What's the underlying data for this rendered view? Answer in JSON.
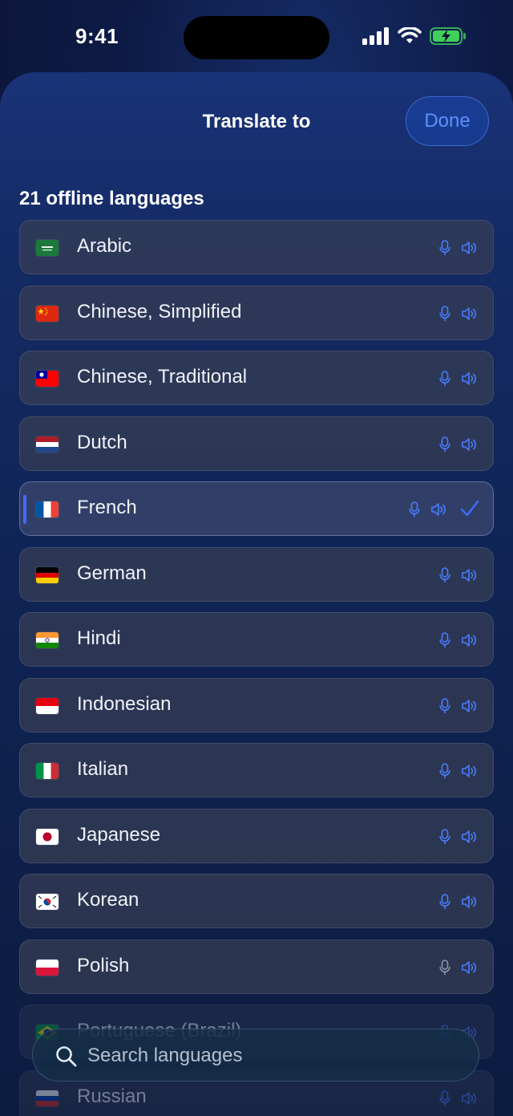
{
  "status": {
    "time": "9:41"
  },
  "sheet": {
    "title": "Translate to",
    "done_label": "Done",
    "section_header": "21 offline languages"
  },
  "languages": [
    {
      "name": "Arabic",
      "flag": "sa",
      "selected": false
    },
    {
      "name": "Chinese, Simplified",
      "flag": "cn",
      "selected": false
    },
    {
      "name": "Chinese, Traditional",
      "flag": "tw",
      "selected": false
    },
    {
      "name": "Dutch",
      "flag": "nl",
      "selected": false
    },
    {
      "name": "French",
      "flag": "fr",
      "selected": true
    },
    {
      "name": "German",
      "flag": "de",
      "selected": false
    },
    {
      "name": "Hindi",
      "flag": "in",
      "selected": false
    },
    {
      "name": "Indonesian",
      "flag": "id",
      "selected": false
    },
    {
      "name": "Italian",
      "flag": "it",
      "selected": false
    },
    {
      "name": "Japanese",
      "flag": "jp",
      "selected": false
    },
    {
      "name": "Korean",
      "flag": "kr",
      "selected": false
    },
    {
      "name": "Polish",
      "flag": "pl",
      "selected": false
    },
    {
      "name": "Portuguese (Brazil)",
      "flag": "br",
      "selected": false
    },
    {
      "name": "Russian",
      "flag": "ru",
      "selected": false
    }
  ],
  "search": {
    "placeholder": "Search languages"
  },
  "colors": {
    "accent": "#3f6dff",
    "icon_blue": "#4a7cff",
    "icon_gray": "#8a93a8",
    "done_text": "#5d8fff"
  },
  "icons": [
    "mic-icon",
    "speaker-icon",
    "checkmark-icon",
    "search-icon",
    "cellular-icon",
    "wifi-icon",
    "battery-icon"
  ]
}
